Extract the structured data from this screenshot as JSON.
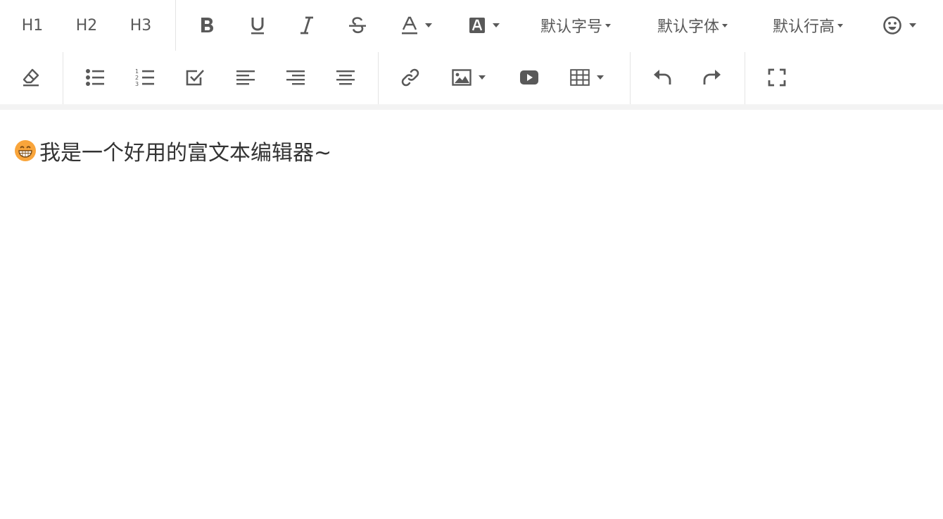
{
  "toolbar": {
    "headings": [
      "H1",
      "H2",
      "H3"
    ],
    "font_size_label": "默认字号",
    "font_family_label": "默认字体",
    "line_height_label": "默认行高",
    "icons": {
      "bold": "bold-icon",
      "underline": "underline-icon",
      "italic": "italic-icon",
      "strikethrough": "strikethrough-icon",
      "font_color": "font-color-icon",
      "background_color": "background-color-icon",
      "emotion": "emoji-icon",
      "clear_format": "eraser-icon",
      "bulleted_list": "bulleted-list-icon",
      "numbered_list": "numbered-list-icon",
      "todo": "todo-checkbox-icon",
      "align_left": "align-left-icon",
      "align_right": "align-right-icon",
      "align_center": "align-center-icon",
      "link": "link-icon",
      "image": "image-icon",
      "video": "video-icon",
      "table": "table-icon",
      "undo": "undo-icon",
      "redo": "redo-icon",
      "fullscreen": "fullscreen-icon"
    },
    "colors": {
      "icon": "#595959",
      "divider": "#e4e4e4",
      "toolbar_bottom_band": "#f3f3f3"
    }
  },
  "content": {
    "paragraph_text": "我是一个好用的富文本编辑器~",
    "emoji": "grinning-face-emoji"
  }
}
